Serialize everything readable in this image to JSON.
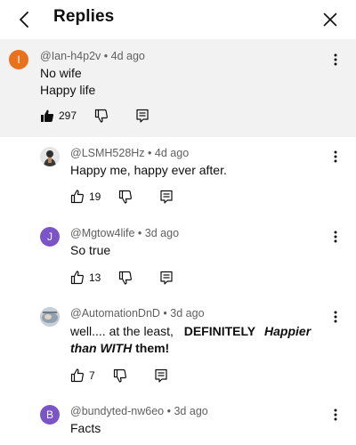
{
  "header": {
    "title": "Replies",
    "back_icon": "back-arrow-icon",
    "close_icon": "close-icon"
  },
  "comments": [
    {
      "avatar_letter": "I",
      "avatar_color": "#e8711c",
      "author": "@Ian-h4p2v",
      "time": "4d ago",
      "lines": [
        "No wife",
        "Happy life"
      ],
      "likes": "297",
      "liked": true
    },
    {
      "avatar_type": "photo",
      "author": "@LSMH528Hz",
      "time": "4d ago",
      "text": "Happy me, happy ever after.",
      "likes": "19"
    },
    {
      "avatar_letter": "J",
      "avatar_color": "#7b55c7",
      "author": "@Mgtow4life",
      "time": "3d ago",
      "text": "So true",
      "likes": "13"
    },
    {
      "avatar_type": "photo",
      "author": "@AutomationDnD",
      "time": "3d ago",
      "text_parts": {
        "p1": "well.... at the least, ",
        "p2": "DEFINITELY",
        "p3": "Happier",
        "p4": "than WITH",
        "p5": "them!"
      },
      "likes": "7"
    },
    {
      "avatar_letter": "B",
      "avatar_color": "#7b55c7",
      "author": "@bundyted-nw6eo",
      "time": "3d ago",
      "text": "Facts"
    }
  ],
  "separator": "•"
}
